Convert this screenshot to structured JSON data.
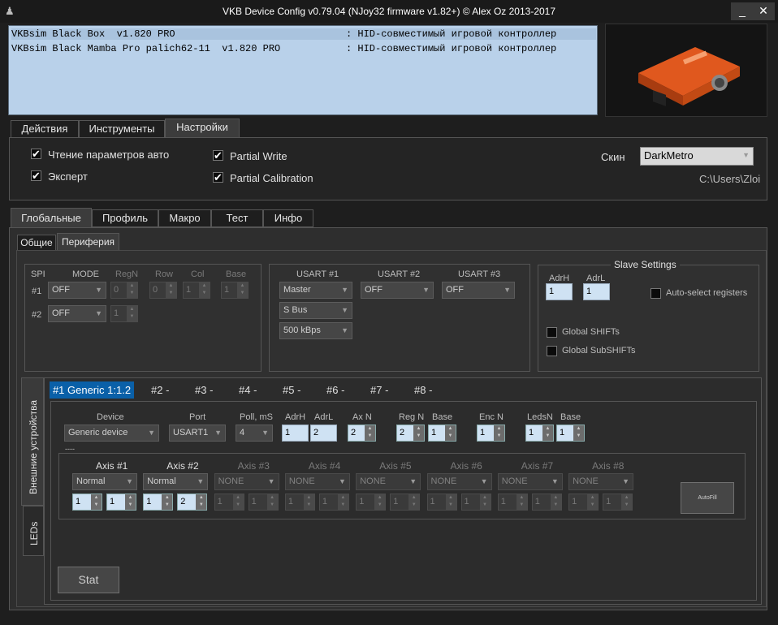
{
  "window": {
    "title": "VKB Device Config v0.79.04 (NJoy32 firmware v1.82+) © Alex Oz 2013-2017",
    "minimize": "_",
    "close": "✕"
  },
  "devices": [
    {
      "name": "VKBsim Black Box  v1.820 PRO",
      "type": ": HID-совместимый игровой контроллер"
    },
    {
      "name": "VKBsim Black Mamba Pro palich62-11  v1.820 PRO",
      "type": ": HID-совместимый игровой контроллер"
    }
  ],
  "main_tabs": [
    "Действия",
    "Инструменты",
    "Настройки"
  ],
  "settings": {
    "read_params_auto": "Чтение параметров авто",
    "expert": "Эксперт",
    "partial_write": "Partial Write",
    "partial_calibration": "Partial Calibration",
    "skin_label": "Скин",
    "skin_value": "DarkMetro",
    "path": "C:\\Users\\Zloi"
  },
  "sub_tabs": [
    "Глобальные",
    "Профиль",
    "Макро",
    "Тест",
    "Инфо"
  ],
  "inner_tabs": [
    "Общие",
    "Периферия"
  ],
  "spi": {
    "title": "SPI",
    "headers": [
      "MODE",
      "RegN",
      "Row",
      "Col",
      "Base"
    ],
    "rows": [
      {
        "label": "#1",
        "mode": "OFF",
        "regn": "0",
        "row": "0",
        "col": "1",
        "base": "1"
      },
      {
        "label": "#2",
        "mode": "OFF",
        "regn": "1"
      }
    ]
  },
  "usart": {
    "headers": [
      "USART #1",
      "USART #2",
      "USART #3"
    ],
    "u1": [
      "Master",
      "S Bus",
      "500 kBps"
    ],
    "u2": "OFF",
    "u3": "OFF"
  },
  "slave": {
    "title": "Slave Settings",
    "adrh_label": "AdrH",
    "adrl_label": "AdrL",
    "adrh": "1",
    "adrl": "1",
    "auto_select": "Auto-select registers",
    "global_shifts": "Global SHIFTs",
    "global_subshifts": "Global SubSHIFTs"
  },
  "side_tabs": [
    "Внешние устройства",
    "LEDs"
  ],
  "ext_tabs": [
    "#1 Generic 1:1.2",
    "#2 -",
    "#3 -",
    "#4 -",
    "#5 -",
    "#6 -",
    "#7 -",
    "#8 -"
  ],
  "ext": {
    "device_label": "Device",
    "device_value": "Generic device",
    "port_label": "Port",
    "port_value": "USART1",
    "poll_label": "Poll, mS",
    "poll_value": "4",
    "adrh_label": "AdrH",
    "adrh": "1",
    "adrl_label": "AdrL",
    "adrl": "2",
    "axn_label": "Ax N",
    "axn": "2",
    "regn_label": "Reg N",
    "regn": "2",
    "base1_label": "Base",
    "base1": "1",
    "encn_label": "Enc N",
    "encn": "1",
    "ledsn_label": "LedsN",
    "ledsn": "1",
    "base2_label": "Base",
    "base2": "1",
    "separator": "----"
  },
  "axes": [
    {
      "label": "Axis #1",
      "mode": "Normal",
      "a": "1",
      "b": "1",
      "enabled": true
    },
    {
      "label": "Axis #2",
      "mode": "Normal",
      "a": "1",
      "b": "2",
      "enabled": true
    },
    {
      "label": "Axis #3",
      "mode": "NONE",
      "a": "1",
      "b": "1",
      "enabled": false
    },
    {
      "label": "Axis #4",
      "mode": "NONE",
      "a": "1",
      "b": "1",
      "enabled": false
    },
    {
      "label": "Axis #5",
      "mode": "NONE",
      "a": "1",
      "b": "1",
      "enabled": false
    },
    {
      "label": "Axis #6",
      "mode": "NONE",
      "a": "1",
      "b": "1",
      "enabled": false
    },
    {
      "label": "Axis #7",
      "mode": "NONE",
      "a": "1",
      "b": "1",
      "enabled": false
    },
    {
      "label": "Axis #8",
      "mode": "NONE",
      "a": "1",
      "b": "1",
      "enabled": false
    }
  ],
  "buttons": {
    "autofill": "AutoFill",
    "stat": "Stat"
  }
}
